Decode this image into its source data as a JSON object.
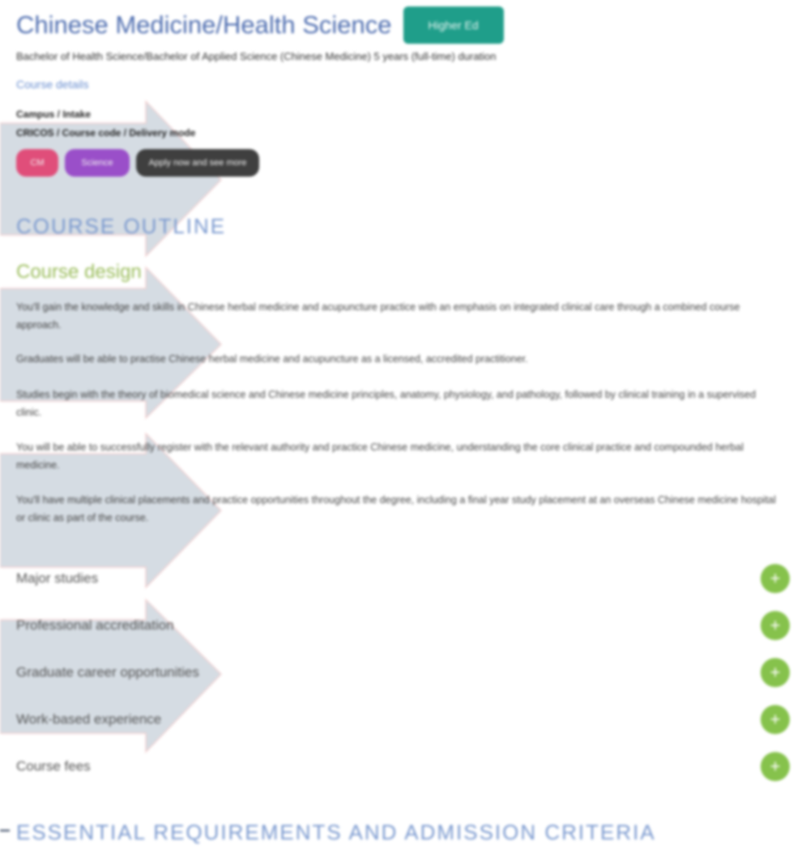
{
  "header": {
    "title": "Chinese Medicine/Health Science",
    "tag": "Higher Ed",
    "subtitle": "Bachelor of Health Science/Bachelor of Applied Science (Chinese Medicine) 5 years (full-time) duration",
    "link": "Course details",
    "label_primary": "Campus / Intake",
    "label_secondary": "CRICOS / Course code / Delivery mode",
    "pills": [
      "CM",
      "Science",
      "Apply now and see more"
    ],
    "pill_colors": [
      "#e04e7a",
      "#9a4fc9",
      "#3f3f3f"
    ]
  },
  "course_structure": {
    "heading": "COURSE OUTLINE",
    "design_heading": "Course design",
    "paragraphs": [
      "You'll gain the knowledge and skills in Chinese herbal medicine and acupuncture practice with an emphasis on integrated clinical care through a combined course approach.",
      "Graduates will be able to practise Chinese herbal medicine and acupuncture as a licensed, accredited practitioner.",
      "Studies begin with the theory of biomedical science and Chinese medicine principles, anatomy, physiology, and pathology, followed by clinical training in a supervised clinic.",
      "You will be able to successfully register with the relevant authority and practice Chinese medicine, understanding the core clinical practice and compounded herbal medicine.",
      "You'll have multiple clinical placements and practice opportunities throughout the degree, including a final year study placement at an overseas Chinese medicine hospital or clinic as part of the course."
    ]
  },
  "accordion": {
    "items": [
      "Major studies",
      "Professional accreditation",
      "Graduate career opportunities",
      "Work-based experience",
      "Course fees"
    ],
    "plus_symbol": "+",
    "accent_color": "#86c24c"
  },
  "footer": {
    "heading": "ESSENTIAL REQUIREMENTS AND ADMISSION CRITERIA"
  },
  "theme": {
    "title_color": "#4f6eb0",
    "tag_color": "#1f9e8a",
    "overlay_color": "#cfd8df"
  }
}
